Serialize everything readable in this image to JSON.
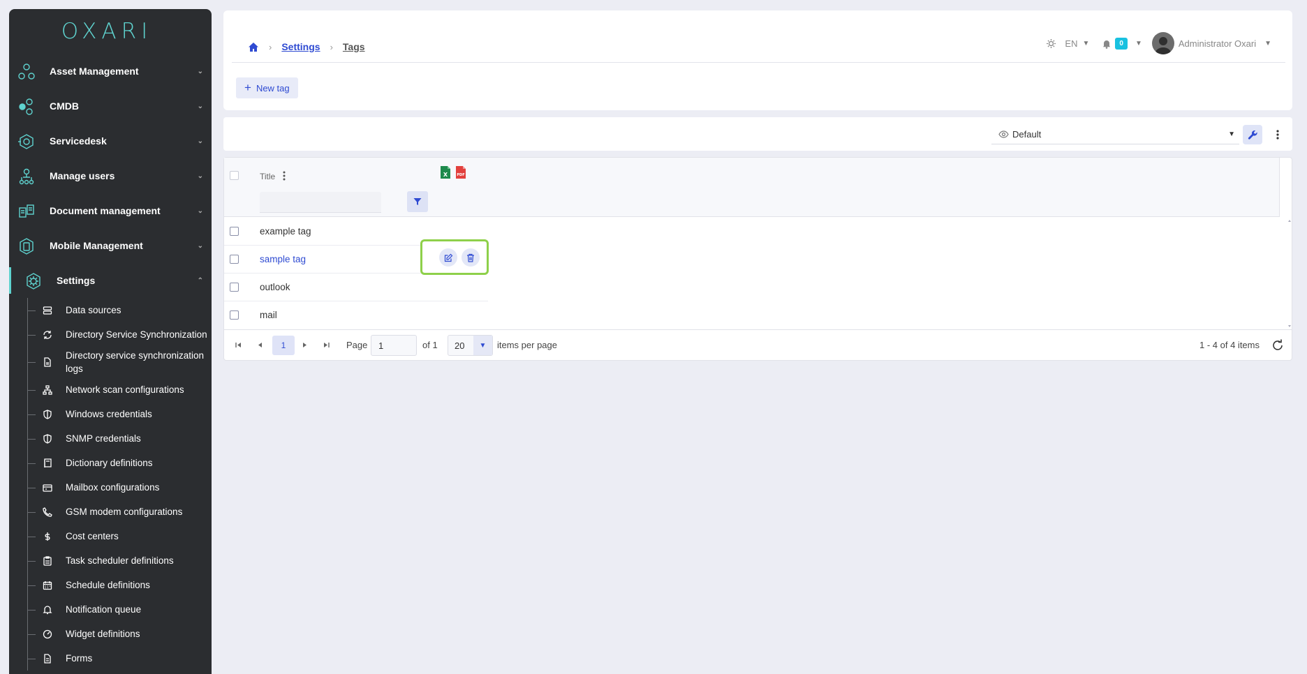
{
  "app": {
    "logo": "OXARI"
  },
  "sidebar": {
    "items": [
      {
        "label": "Asset Management",
        "icon": "asset-management-icon",
        "expanded": false
      },
      {
        "label": "CMDB",
        "icon": "cmdb-icon",
        "expanded": false
      },
      {
        "label": "Servicedesk",
        "icon": "servicedesk-icon",
        "expanded": false
      },
      {
        "label": "Manage users",
        "icon": "manage-users-icon",
        "expanded": false
      },
      {
        "label": "Document management",
        "icon": "document-management-icon",
        "expanded": false
      },
      {
        "label": "Mobile Management",
        "icon": "mobile-management-icon",
        "expanded": false
      },
      {
        "label": "Settings",
        "icon": "settings-icon",
        "expanded": true
      }
    ],
    "settings_children": [
      {
        "label": "Data sources",
        "icon": "database-icon"
      },
      {
        "label": "Directory Service Synchronization",
        "icon": "sync-icon"
      },
      {
        "label": "Directory service synchronization logs",
        "icon": "file-icon"
      },
      {
        "label": "Network scan configurations",
        "icon": "network-icon"
      },
      {
        "label": "Windows credentials",
        "icon": "shield-icon"
      },
      {
        "label": "SNMP credentials",
        "icon": "shield-icon"
      },
      {
        "label": "Dictionary definitions",
        "icon": "book-icon"
      },
      {
        "label": "Mailbox configurations",
        "icon": "mailbox-icon"
      },
      {
        "label": "GSM modem configurations",
        "icon": "phone-icon"
      },
      {
        "label": "Cost centers",
        "icon": "dollar-icon"
      },
      {
        "label": "Task scheduler definitions",
        "icon": "clipboard-icon"
      },
      {
        "label": "Schedule definitions",
        "icon": "calendar-icon"
      },
      {
        "label": "Notification queue",
        "icon": "bell-icon"
      },
      {
        "label": "Widget definitions",
        "icon": "gauge-icon"
      },
      {
        "label": "Forms",
        "icon": "form-icon"
      }
    ]
  },
  "header": {
    "breadcrumb": {
      "parent": "Settings",
      "current": "Tags"
    },
    "language": "EN",
    "notification_count": "0",
    "user_name": "Administrator Oxari",
    "new_button": "New tag"
  },
  "view": {
    "selected": "Default"
  },
  "grid": {
    "column_title": "Title",
    "rows": [
      {
        "title": "example tag",
        "hovered": false
      },
      {
        "title": "sample tag",
        "hovered": true
      },
      {
        "title": "outlook",
        "hovered": false
      },
      {
        "title": "mail",
        "hovered": false
      }
    ],
    "pager": {
      "current_page": "1",
      "page_label": "Page",
      "page_input": "1",
      "of_label": "of 1",
      "page_size": "20",
      "per_page_label": "items per page",
      "info": "1 - 4 of 4 items"
    }
  },
  "colors": {
    "accent": "#2f4bd2",
    "brand": "#5fd3cf",
    "sidebar_bg": "#2b2d30",
    "highlight": "#8ed04a",
    "badge": "#19c1e0"
  }
}
